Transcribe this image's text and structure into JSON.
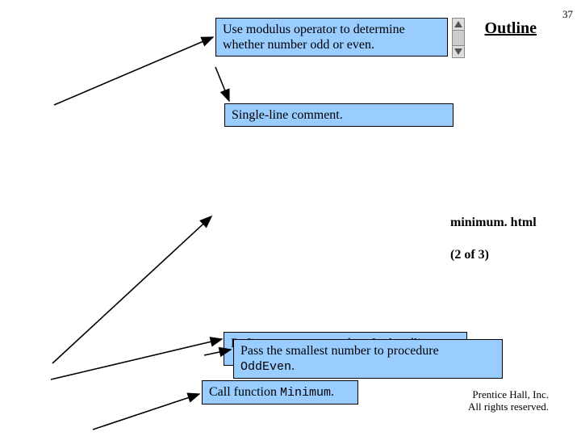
{
  "slide_number": "37",
  "header": {
    "outline": "Outline"
  },
  "caption": {
    "file": "minimum. html",
    "pager": "(2 of 3)"
  },
  "callouts": {
    "modulus": "Use modulus operator to determine whether number odd or even.",
    "single_line": "Single-line comment.",
    "event_proc_partial": "Define an event procedure for handling",
    "pass_small": "Pass the smallest number to procedure ",
    "pass_small_code": "OddEven",
    "pass_small_dot": ".",
    "call_fn_pre": "Call function ",
    "call_fn_fn": "Minimum",
    "call_fn_dot": "."
  },
  "copyright": {
    "line1": "Prentice Hall, Inc.",
    "line2": "All rights reserved."
  }
}
